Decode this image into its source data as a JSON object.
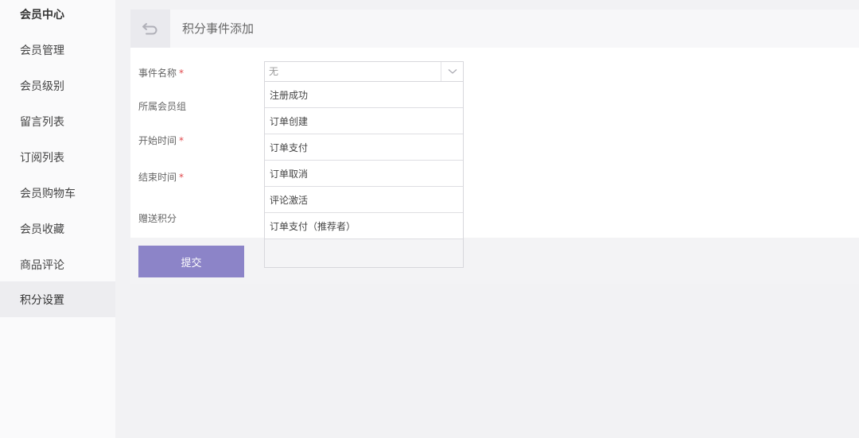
{
  "sidebar": {
    "title": "会员中心",
    "items": [
      {
        "label": "会员管理"
      },
      {
        "label": "会员级别"
      },
      {
        "label": "留言列表"
      },
      {
        "label": "订阅列表"
      },
      {
        "label": "会员购物车"
      },
      {
        "label": "会员收藏"
      },
      {
        "label": "商品评论"
      },
      {
        "label": "积分设置"
      }
    ],
    "active_item": "积分设置"
  },
  "header": {
    "back_icon": "back-arrow-icon",
    "title": "积分事件添加"
  },
  "form": {
    "event_name": {
      "label": "事件名称",
      "required_mark": "*",
      "value": "无"
    },
    "member_group": {
      "label": "所属会员组"
    },
    "start_time": {
      "label": "开始时间",
      "required_mark": "*"
    },
    "end_time": {
      "label": "结束时间",
      "required_mark": "*"
    },
    "bonus_points": {
      "label": "赠送积分"
    },
    "submit_label": "提交"
  },
  "dropdown": {
    "options": [
      "注册成功",
      "订单创建",
      "订单支付",
      "订单取消",
      "评论激活",
      "订单支付（推荐者）"
    ]
  },
  "colors": {
    "accent": "#8c84c8",
    "required": "#e0484c",
    "sidebar_bg": "#fafafb",
    "page_bg": "#f2f2f4"
  }
}
